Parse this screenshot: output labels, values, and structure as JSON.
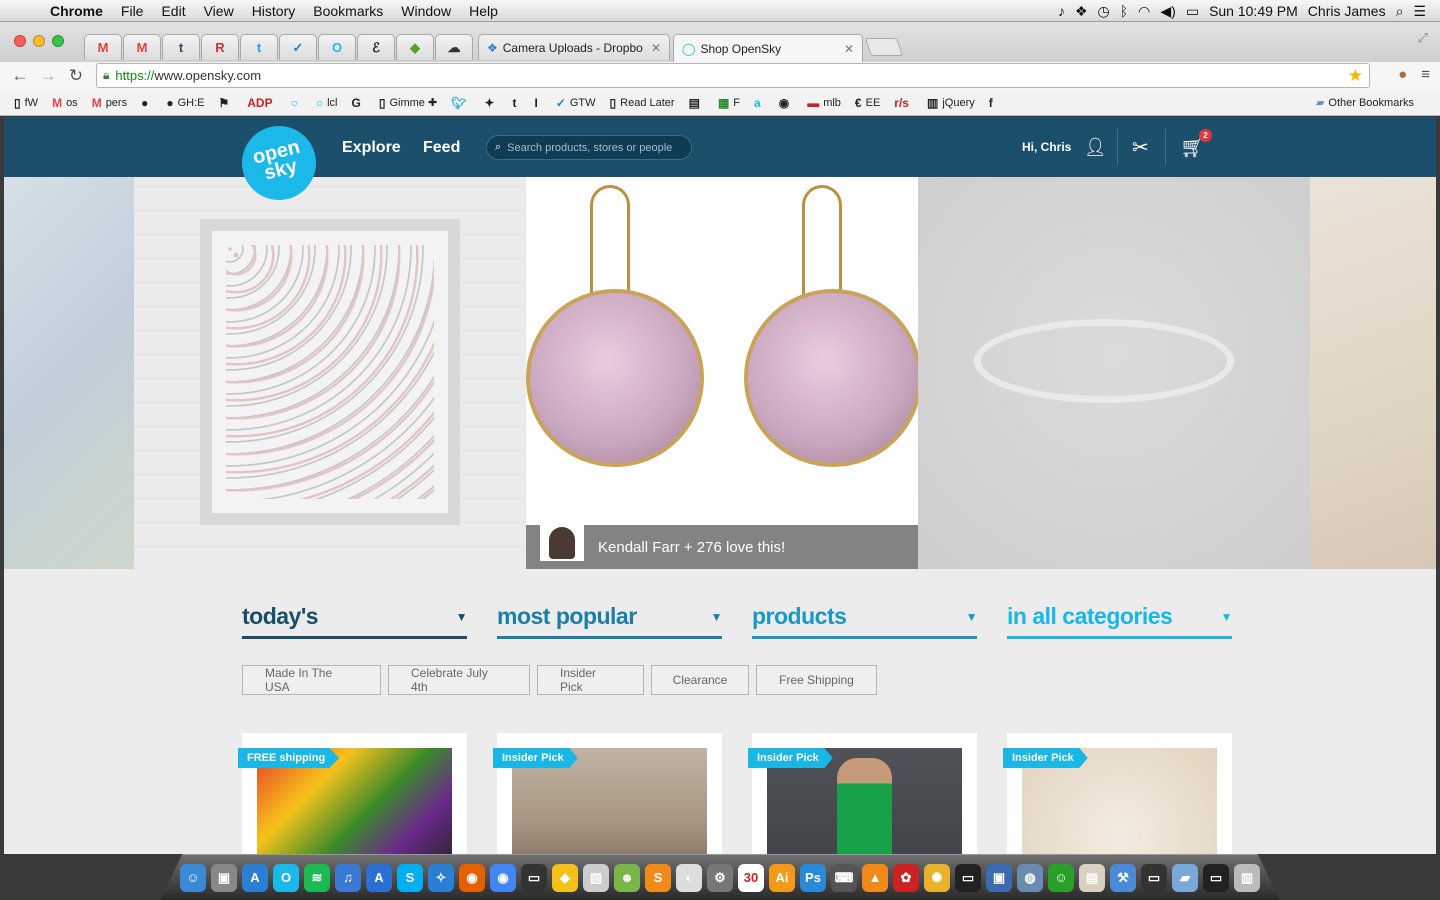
{
  "menubar": {
    "app": "Chrome",
    "items": [
      "File",
      "Edit",
      "View",
      "History",
      "Bookmarks",
      "Window",
      "Help"
    ],
    "clock": "Sun 10:49 PM",
    "user": "Chris James"
  },
  "tabs": {
    "pinned": [
      "M",
      "M",
      "t",
      "R",
      "t",
      "✓",
      "O",
      "ℰ",
      "◆",
      "☁"
    ],
    "open": [
      {
        "title": "Camera Uploads - Dropbo",
        "active": false
      },
      {
        "title": "Shop OpenSky",
        "active": true
      }
    ]
  },
  "toolbar": {
    "url_scheme": "https://",
    "url_host": "www.opensky.com"
  },
  "bookmarks": [
    {
      "icon": "doc-icon",
      "label": "fW"
    },
    {
      "icon": "gmail-icon",
      "label": "os"
    },
    {
      "icon": "gmail-icon",
      "label": "pers"
    },
    {
      "icon": "github-icon",
      "label": ""
    },
    {
      "icon": "github-icon",
      "label": "GH:E"
    },
    {
      "icon": "flag-icon",
      "label": ""
    },
    {
      "icon": "adp-icon",
      "label": ""
    },
    {
      "icon": "opensky-icon",
      "label": ""
    },
    {
      "icon": "opensky-icon",
      "label": "lcl"
    },
    {
      "icon": "g-icon",
      "label": ""
    },
    {
      "icon": "doc-icon",
      "label": "Gimme ✚"
    },
    {
      "icon": "twitter-icon",
      "label": ""
    },
    {
      "icon": "puzzle-icon",
      "label": ""
    },
    {
      "icon": "tumblr-icon",
      "label": ""
    },
    {
      "icon": "info-icon",
      "label": ""
    },
    {
      "icon": "check-icon",
      "label": "GTW"
    },
    {
      "icon": "doc-icon",
      "label": "Read Later"
    },
    {
      "icon": "page-icon",
      "label": ""
    },
    {
      "icon": "sheet-icon",
      "label": "F"
    },
    {
      "icon": "a-icon",
      "label": ""
    },
    {
      "icon": "chrome-icon",
      "label": ""
    },
    {
      "icon": "mlb-icon",
      "label": "mlb"
    },
    {
      "icon": "ee-icon",
      "label": "EE"
    },
    {
      "icon": "rs-icon",
      "label": ""
    },
    {
      "icon": "jquery-icon",
      "label": "jQuery"
    },
    {
      "icon": "f-icon",
      "label": ""
    }
  ],
  "other_bookmarks": "Other Bookmarks",
  "site": {
    "logo_line1": "open",
    "logo_line2": "sky",
    "nav": [
      "Explore",
      "Feed"
    ],
    "search_placeholder": "Search products, stores or people",
    "greeting": "Hi, Chris",
    "cart_count": "2",
    "hero_caption": "Kendall Farr + 276 love this!",
    "filters": [
      "today's",
      "most popular",
      "products",
      "in all categories"
    ],
    "tags": [
      "Made In The USA",
      "Celebrate July 4th",
      "Insider Pick",
      "Clearance",
      "Free Shipping"
    ],
    "cards": [
      {
        "badge": "FREE shipping"
      },
      {
        "badge": "Insider Pick"
      },
      {
        "badge": "Insider Pick"
      },
      {
        "badge": "Insider Pick"
      }
    ]
  },
  "colors": {
    "site_header": "#1c4f6c",
    "brand_blue": "#1bb9ea",
    "badge": "#18b7e6"
  }
}
